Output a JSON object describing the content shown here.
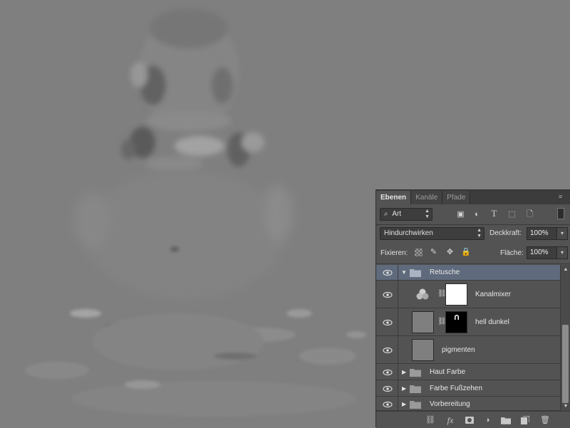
{
  "tabs": [
    {
      "label": "Ebenen",
      "active": true
    },
    {
      "label": "Kanäle",
      "active": false
    },
    {
      "label": "Pfade",
      "active": false
    }
  ],
  "filter": {
    "kind_label": "Art",
    "icons": [
      "image-filter-icon",
      "adjustment-filter-icon",
      "type-filter-icon",
      "shape-filter-icon",
      "smartobject-filter-icon",
      "filter-toggle-icon"
    ]
  },
  "blend": {
    "mode": "Hindurchwirken",
    "opacity_label": "Deckkraft:",
    "opacity_value": "100%"
  },
  "lock": {
    "label": "Fixieren:",
    "fill_label": "Fläche:",
    "fill_value": "100%"
  },
  "layers": [
    {
      "name": "Retusche",
      "type": "group",
      "expanded": true,
      "selected": true
    },
    {
      "name": "Kanalmixer",
      "type": "adjustment",
      "mask": "white"
    },
    {
      "name": "hell dunkel",
      "type": "pixel-mask",
      "mask": "black"
    },
    {
      "name": "pigmenten",
      "type": "pixel"
    },
    {
      "name": "Haut Farbe",
      "type": "group",
      "expanded": false
    },
    {
      "name": "Farbe Fußzehen",
      "type": "group",
      "expanded": false
    },
    {
      "name": "Vorbereitung",
      "type": "group",
      "expanded": false
    }
  ],
  "footer_icons": [
    "link-layers-icon",
    "fx-icon",
    "add-mask-icon",
    "new-adjustment-icon",
    "new-group-icon",
    "new-layer-icon",
    "delete-layer-icon"
  ],
  "footer_fx_label": "fx",
  "colors": {
    "panel_bg": "#535353",
    "selection": "#5f6a7c",
    "canvas_gray": "#7f7f7f"
  }
}
